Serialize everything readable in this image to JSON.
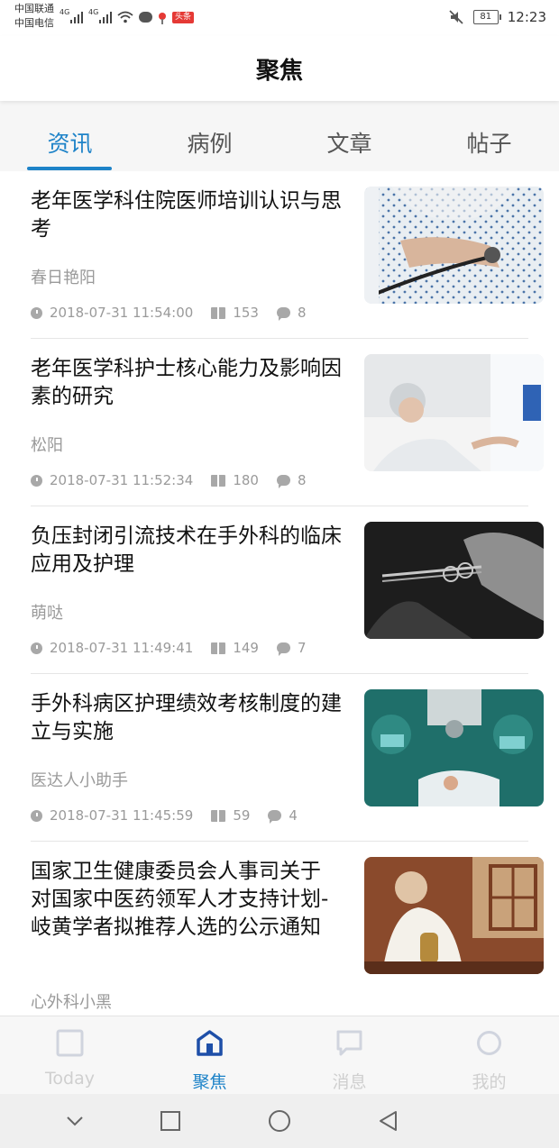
{
  "status_bar": {
    "carrier_1": "中国联通",
    "carrier_2": "中国电信",
    "net_1": "4G",
    "net_2": "4G",
    "news_badge": "头条",
    "battery": "81",
    "time": "12:23"
  },
  "header": {
    "title": "聚焦"
  },
  "tabs": [
    {
      "label": "资讯",
      "active": true
    },
    {
      "label": "病例",
      "active": false
    },
    {
      "label": "文章",
      "active": false
    },
    {
      "label": "帖子",
      "active": false
    }
  ],
  "articles": [
    {
      "title": "老年医学科住院医师培训认识与思考",
      "author": "春日艳阳",
      "datetime": "2018-07-31 11:54:00",
      "reads": "153",
      "comments": "8",
      "thumb": "doctor-stethoscope-photo"
    },
    {
      "title": "老年医学科护士核心能力及影响因素的研究",
      "author": "松阳",
      "datetime": "2018-07-31 11:52:34",
      "reads": "180",
      "comments": "8",
      "thumb": "elderly-patient-bed-photo"
    },
    {
      "title": "负压封闭引流技术在手外科的临床应用及护理",
      "author": "萌哒",
      "datetime": "2018-07-31 11:49:41",
      "reads": "149",
      "comments": "7",
      "thumb": "surgical-scissors-gloves-photo"
    },
    {
      "title": "手外科病区护理绩效考核制度的建立与实施",
      "author": "医达人小助手",
      "datetime": "2018-07-31 11:45:59",
      "reads": "59",
      "comments": "4",
      "thumb": "surgery-team-photo"
    },
    {
      "title": "国家卫生健康委员会人事司关于 对国家中医药领军人才支持计划-岐黄学者拟推荐人选的公示通知",
      "author": "心外科小黑",
      "thumb": "tcm-doctor-photo"
    }
  ],
  "bottom_nav": [
    {
      "label": "Today",
      "icon": "today-icon",
      "active": false
    },
    {
      "label": "聚焦",
      "icon": "focus-home-icon",
      "active": true
    },
    {
      "label": "消息",
      "icon": "message-icon",
      "active": false
    },
    {
      "label": "我的",
      "icon": "profile-icon",
      "active": false
    }
  ],
  "colors": {
    "accent": "#1e83c8",
    "inactive_nav": "#cfcfcf",
    "meta_text": "#9a9a9a"
  }
}
